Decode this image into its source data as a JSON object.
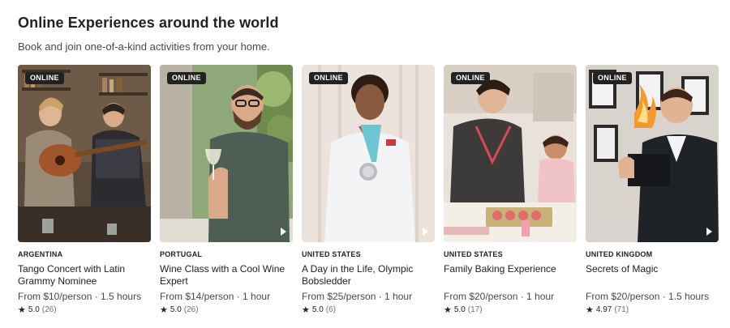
{
  "section": {
    "title": "Online Experiences around the world",
    "subtitle": "Book and join one-of-a-kind activities from your home."
  },
  "cards": [
    {
      "badge": "ONLINE",
      "country": "ARGENTINA",
      "name": "Tango Concert with Latin Grammy Nominee",
      "price": "From $10/person · 1.5 hours",
      "rating": "5.0",
      "reviews": "(26)"
    },
    {
      "badge": "ONLINE",
      "country": "PORTUGAL",
      "name": "Wine Class with a Cool Wine Expert",
      "price": "From $14/person · 1 hour",
      "rating": "5.0",
      "reviews": "(26)"
    },
    {
      "badge": "ONLINE",
      "country": "UNITED STATES",
      "name": "A Day in the Life, Olympic Bobsledder",
      "price": "From $25/person · 1 hour",
      "rating": "5.0",
      "reviews": "(6)"
    },
    {
      "badge": "ONLINE",
      "country": "UNITED STATES",
      "name": "Family Baking Experience",
      "price": "From $20/person · 1 hour",
      "rating": "5.0",
      "reviews": "(17)"
    },
    {
      "badge": "ONLINE",
      "country": "UNITED KINGDOM",
      "name": "Secrets of Magic",
      "price": "From $20/person · 1.5 hours",
      "rating": "4.97",
      "reviews": "(71)"
    }
  ],
  "icons": {
    "star": "star-icon",
    "play": "play-icon"
  }
}
